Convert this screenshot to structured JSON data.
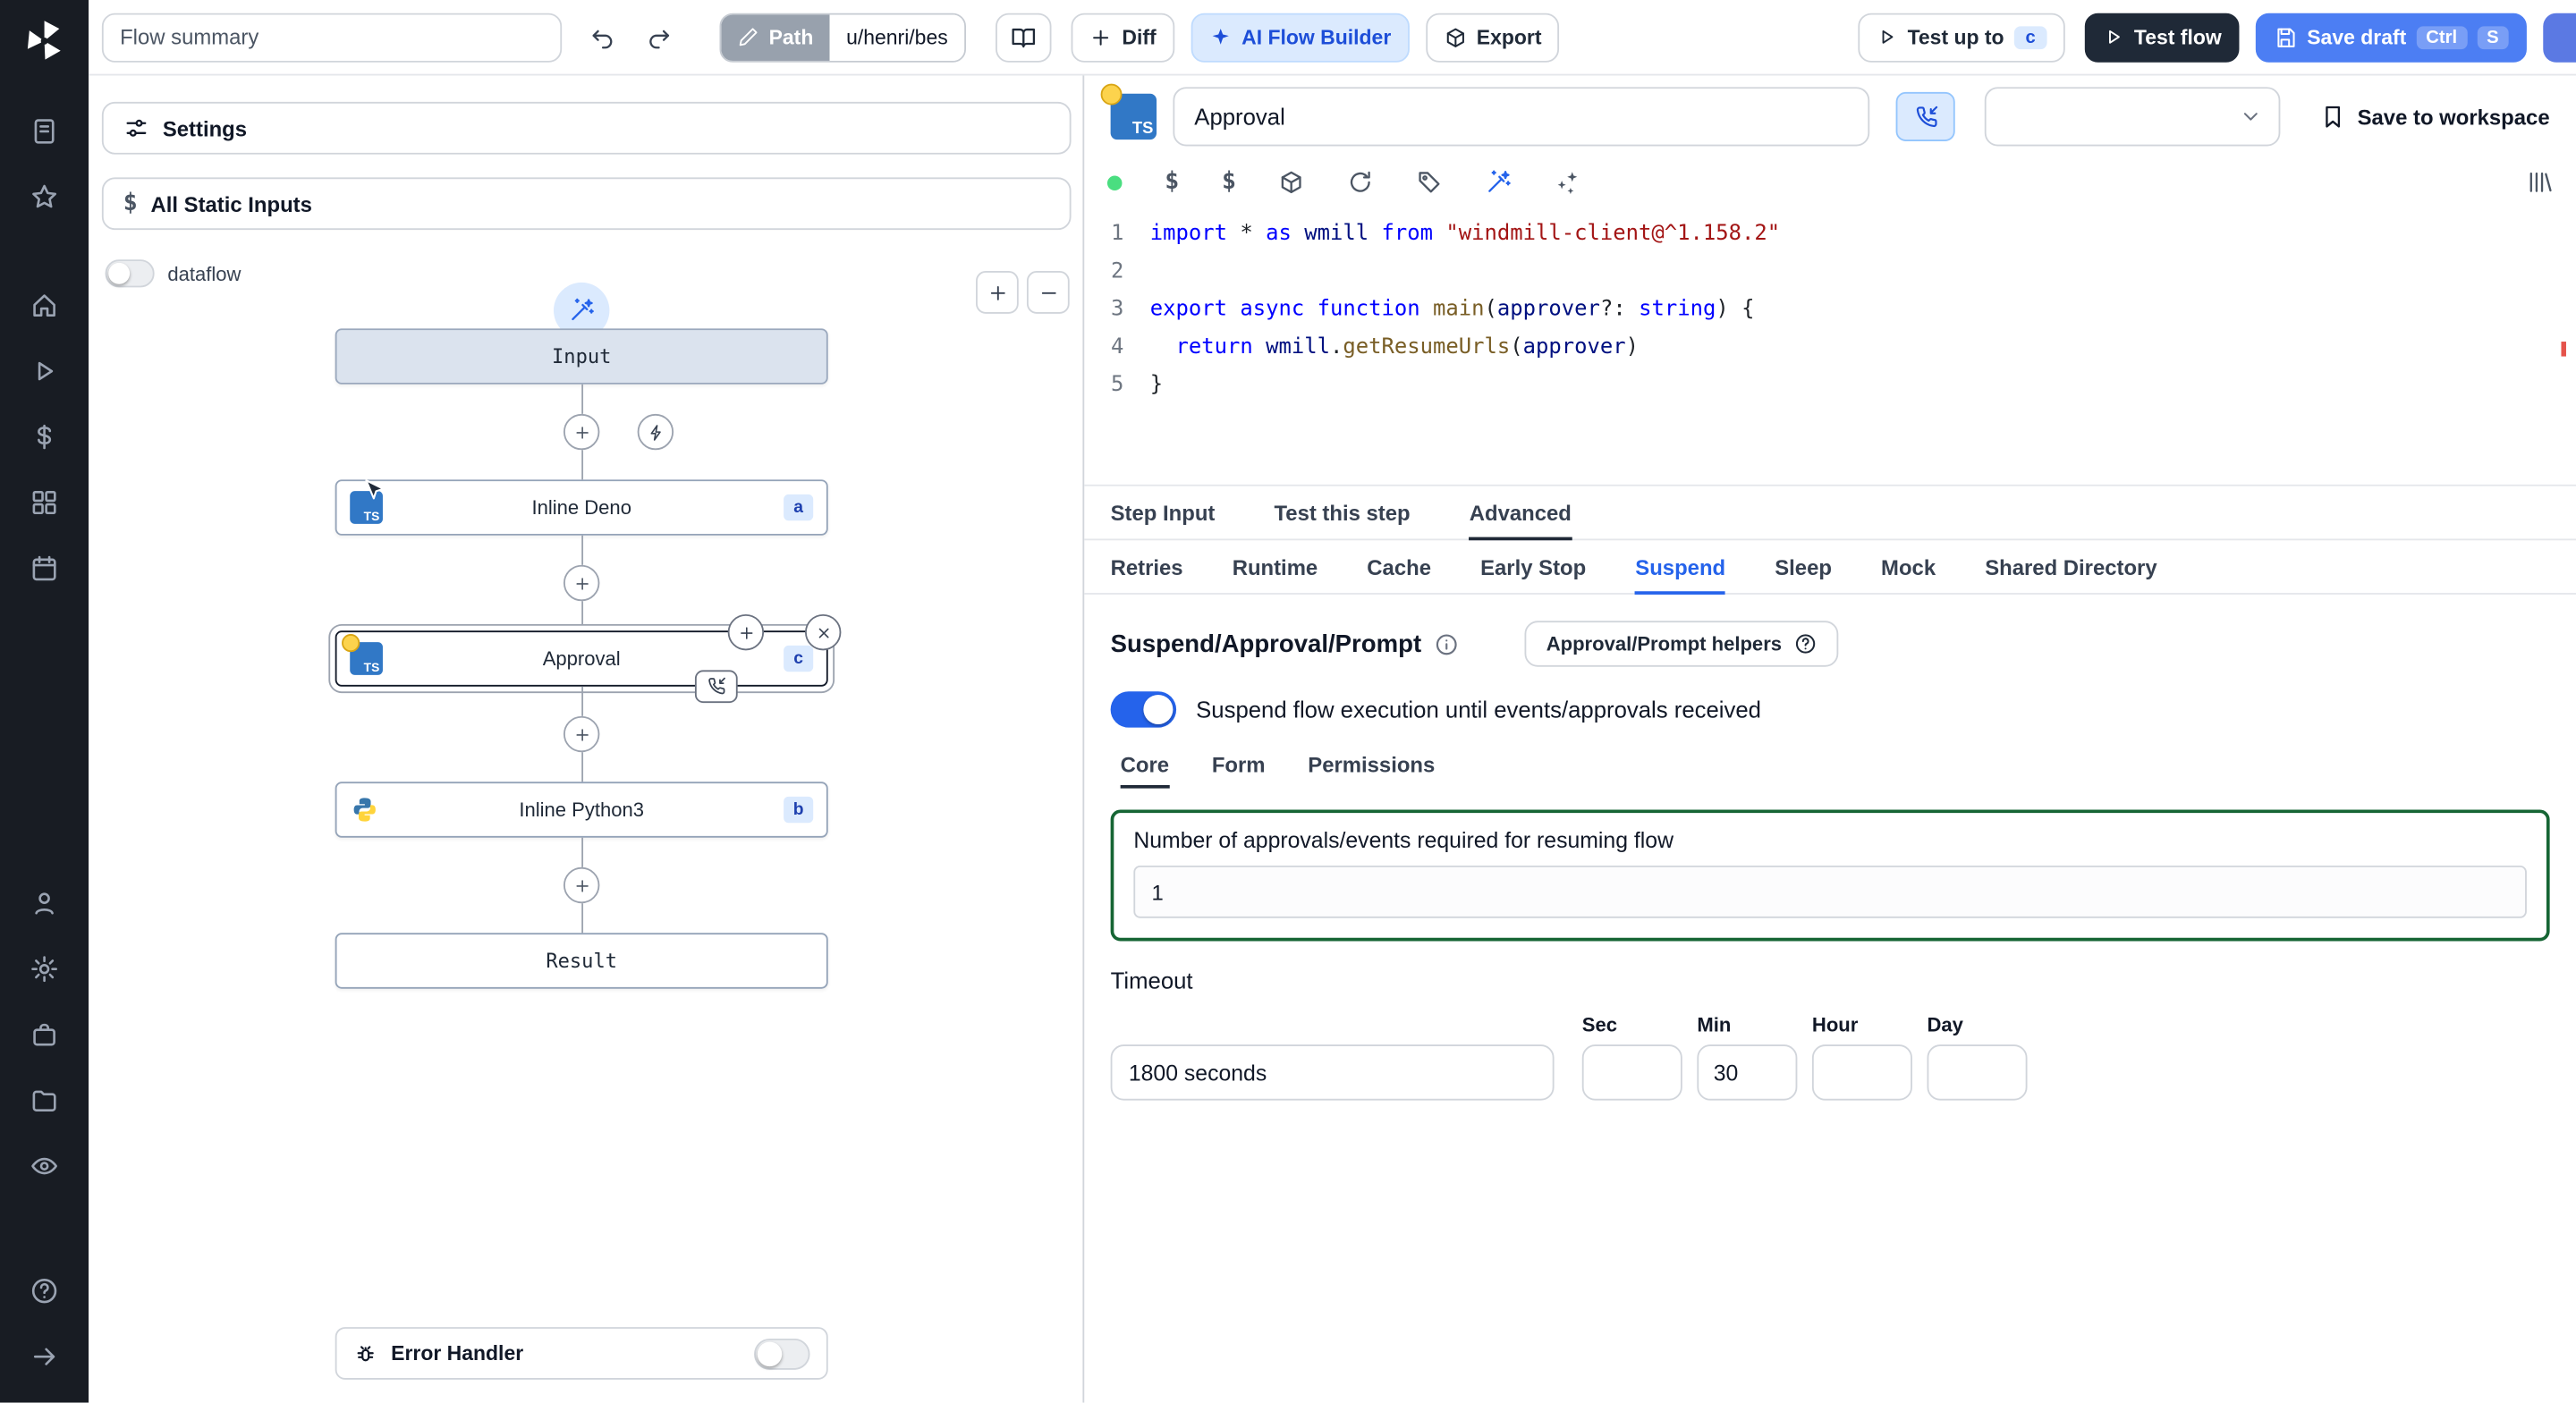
{
  "colors": {
    "accent_blue": "#2563eb",
    "rail_bg": "#181c23",
    "ai_button_bg": "#dbeafe",
    "ai_button_text": "#1d4ed8",
    "test_flow_bg": "#1f2937",
    "save_draft_bg": "#4c7ef3",
    "suspend_green_border": "#166534",
    "valid_dot_green": "#4ade80",
    "code_keyword": "#0000ff",
    "code_string": "#a31515",
    "code_function": "#795e26",
    "typescript_blue": "#3178c6"
  },
  "topbar": {
    "flow_summary_placeholder": "Flow summary",
    "path_label": "Path",
    "path_value": "u/henri/bes",
    "diff_label": "Diff",
    "ai_flow_builder_label": "AI Flow Builder",
    "export_label": "Export",
    "test_up_to_label": "Test up to",
    "test_up_to_badge": "c",
    "test_flow_label": "Test flow",
    "save_draft_label": "Save draft",
    "save_draft_kbd": [
      "Ctrl",
      "S"
    ]
  },
  "flow_panel": {
    "settings_label": "Settings",
    "all_static_inputs_label": "All Static Inputs",
    "dataflow_label": "dataflow",
    "graph": {
      "input_label": "Input",
      "steps": [
        {
          "label": "Inline Deno",
          "badge": "a"
        },
        {
          "label": "Approval",
          "badge": "c"
        },
        {
          "label": "Inline Python3",
          "badge": "b"
        }
      ],
      "result_label": "Result"
    },
    "error_handler_label": "Error Handler"
  },
  "step_editor": {
    "step_name_value": "Approval",
    "save_to_workspace_label": "Save to workspace",
    "code": {
      "lines": [
        {
          "n": 1,
          "tokens": [
            {
              "c": "kw",
              "t": "import"
            },
            {
              "c": "pl",
              "t": " * "
            },
            {
              "c": "kw",
              "t": "as"
            },
            {
              "c": "pl",
              "t": " "
            },
            {
              "c": "var",
              "t": "wmill"
            },
            {
              "c": "pl",
              "t": " "
            },
            {
              "c": "kw",
              "t": "from"
            },
            {
              "c": "pl",
              "t": " "
            },
            {
              "c": "str",
              "t": "\"windmill-client@^1.158.2\""
            }
          ]
        },
        {
          "n": 2,
          "tokens": []
        },
        {
          "n": 3,
          "tokens": [
            {
              "c": "kw",
              "t": "export"
            },
            {
              "c": "pl",
              "t": " "
            },
            {
              "c": "kw",
              "t": "async"
            },
            {
              "c": "pl",
              "t": " "
            },
            {
              "c": "kw",
              "t": "function"
            },
            {
              "c": "pl",
              "t": " "
            },
            {
              "c": "fn",
              "t": "main"
            },
            {
              "c": "pl",
              "t": "("
            },
            {
              "c": "var",
              "t": "approver"
            },
            {
              "c": "pl",
              "t": "?: "
            },
            {
              "c": "kw",
              "t": "string"
            },
            {
              "c": "pl",
              "t": ") {"
            }
          ]
        },
        {
          "n": 4,
          "tokens": [
            {
              "c": "pl",
              "t": "  "
            },
            {
              "c": "kw",
              "t": "return"
            },
            {
              "c": "pl",
              "t": " "
            },
            {
              "c": "var",
              "t": "wmill"
            },
            {
              "c": "pl",
              "t": "."
            },
            {
              "c": "fn",
              "t": "getResumeUrls"
            },
            {
              "c": "pl",
              "t": "("
            },
            {
              "c": "var",
              "t": "approver"
            },
            {
              "c": "pl",
              "t": ")"
            }
          ]
        },
        {
          "n": 5,
          "tokens": [
            {
              "c": "pl",
              "t": "}"
            }
          ]
        }
      ]
    },
    "tabs": {
      "items": [
        "Step Input",
        "Test this step",
        "Advanced"
      ],
      "active": "Advanced"
    },
    "subtabs": {
      "items": [
        "Retries",
        "Runtime",
        "Cache",
        "Early Stop",
        "Suspend",
        "Sleep",
        "Mock",
        "Shared Directory"
      ],
      "active": "Suspend"
    }
  },
  "suspend": {
    "title": "Suspend/Approval/Prompt",
    "helpers_button_label": "Approval/Prompt helpers",
    "toggle_label": "Suspend flow execution until events/approvals received",
    "toggle_on": true,
    "tabs": {
      "items": [
        "Core",
        "Form",
        "Permissions"
      ],
      "active": "Core"
    },
    "approvals_label": "Number of approvals/events required for resuming flow",
    "approvals_value": "1",
    "timeout_label": "Timeout",
    "timeout_value": "1800 seconds",
    "timeout_units": [
      {
        "label": "Sec",
        "value": ""
      },
      {
        "label": "Min",
        "value": "30"
      },
      {
        "label": "Hour",
        "value": ""
      },
      {
        "label": "Day",
        "value": ""
      }
    ]
  }
}
